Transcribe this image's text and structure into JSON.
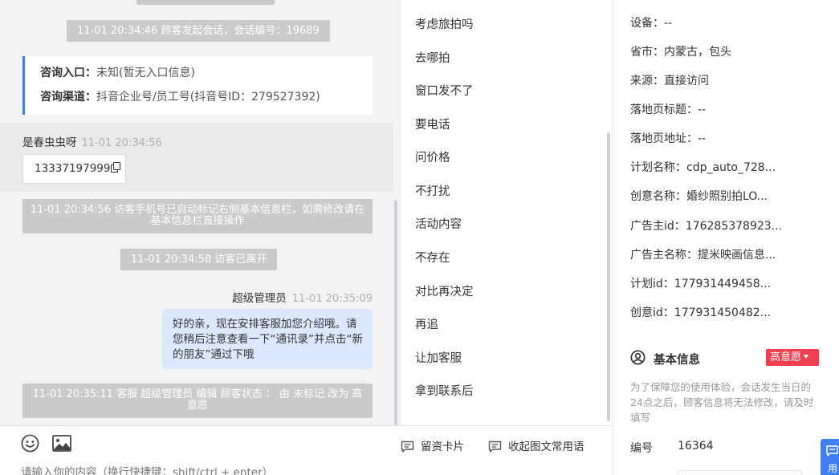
{
  "chat": {
    "system_messages": [
      "11-01 20:34:46 顾客发起会话，会话编号：19689",
      "11-01 20:34:56 访客手机号已自动标记右侧基本信息栏，如需修改请在基本信息栏直接操作",
      "11-01 20:34:58 访客已离开",
      "11-01 20:35:11 客服 超级管理员 编辑 顾客状态 ： 由 未标记 改为 高意愿"
    ],
    "entry_card": {
      "entry_label": "咨询入口：",
      "entry_value": "未知(暂无入口信息)",
      "channel_label": "咨询渠道：",
      "channel_value": "抖音企业号/员工号(抖音号ID：279527392)"
    },
    "guest": {
      "name": "是春虫虫呀",
      "time": "11-01 20:34:56",
      "phone": "13337197999"
    },
    "agent": {
      "name": "超级管理员",
      "time": "11-01 20:35:09",
      "message": "好的亲，现在安排客服加您介绍哦。请您稍后注意查看一下“通讯录”并点击“新的朋友”通过下哦"
    }
  },
  "input": {
    "placeholder": "请输入你的内容（换行快捷键：shift/ctrl + enter）",
    "card_button": "留资卡片",
    "fold_button": "收起图文常用语"
  },
  "quick_phrases": [
    "考虑旅拍吗",
    "去哪拍",
    "窗口发不了",
    "要电话",
    "问价格",
    "不打扰",
    "活动内容",
    "不存在",
    "对比再决定",
    "再追",
    "让加客服",
    "拿到联系后"
  ],
  "info": {
    "rows": [
      {
        "label": "设备：",
        "value": "--"
      },
      {
        "label": "省市：",
        "value": "内蒙古，包头"
      },
      {
        "label": "来源：",
        "value": "直接访问"
      },
      {
        "label": "落地页标题：",
        "value": "--"
      },
      {
        "label": "落地页地址：",
        "value": "--"
      },
      {
        "label": "计划名称：",
        "value": "cdp_auto_728..."
      },
      {
        "label": "创意名称：",
        "value": "婚纱照别拍LO..."
      },
      {
        "label": "广告主id：",
        "value": "176285378923..."
      },
      {
        "label": "广告主名称：",
        "value": "提米映画信息..."
      },
      {
        "label": "计划id：",
        "value": "177931449458..."
      },
      {
        "label": "创意id：",
        "value": "177931450482..."
      }
    ],
    "basic_title": "基本信息",
    "intent_badge": "高意愿",
    "privacy_note": "为了保障您的使用体验，会话发生当日的24点之后，顾客信息将无法修改，请及时填写",
    "id_label": "编号",
    "id_value": "16364"
  },
  "float_button": {
    "label": "用"
  },
  "colors": {
    "accent": "#3f7ef5",
    "badge": "#f0404f",
    "system_bubble": "#c9cacc",
    "agent_bubble": "#dce9fd"
  }
}
